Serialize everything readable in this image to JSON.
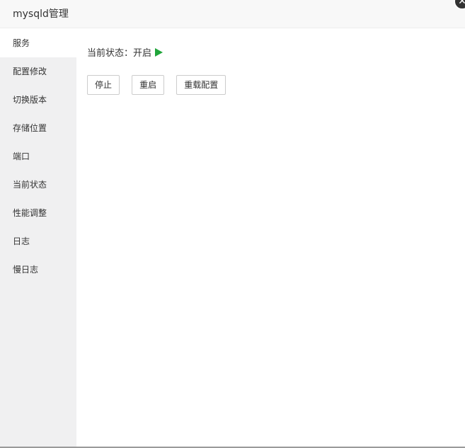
{
  "dialog": {
    "title": "mysqld管理",
    "close_glyph": "✕"
  },
  "sidebar": {
    "items": [
      {
        "label": "服务",
        "active": true
      },
      {
        "label": "配置修改"
      },
      {
        "label": "切换版本"
      },
      {
        "label": "存储位置"
      },
      {
        "label": "端口"
      },
      {
        "label": "当前状态"
      },
      {
        "label": "性能调整"
      },
      {
        "label": "日志"
      },
      {
        "label": "慢日志"
      }
    ]
  },
  "main": {
    "status_label": "当前状态：",
    "status_value": "开启",
    "status_icon": "play-icon",
    "status_color": "#20a53a",
    "buttons": {
      "stop": "停止",
      "restart": "重启",
      "reload": "重载配置"
    }
  }
}
